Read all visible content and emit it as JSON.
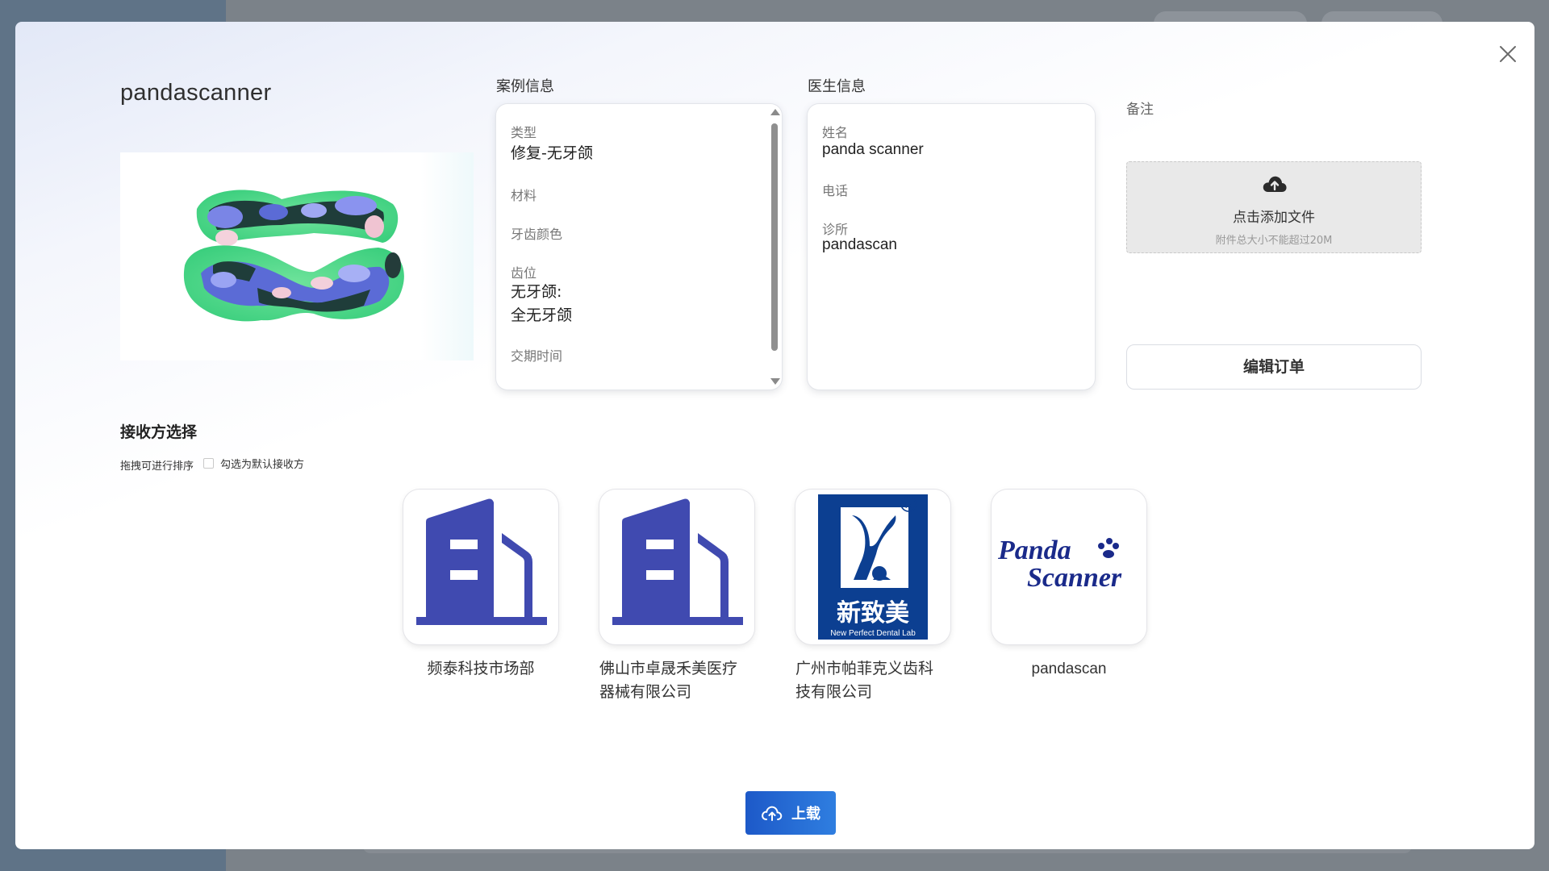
{
  "modal": {
    "title": "pandascanner",
    "case_info": {
      "heading": "案例信息",
      "fields": [
        {
          "label": "类型",
          "value": "修复-无牙颌"
        },
        {
          "label": "材料",
          "value": ""
        },
        {
          "label": "牙齿颜色",
          "value": ""
        },
        {
          "label": "齿位",
          "value_line1": "无牙颌:",
          "value_line2": "全无牙颌"
        },
        {
          "label": "交期时间",
          "value": ""
        }
      ]
    },
    "doctor_info": {
      "heading": "医生信息",
      "fields": [
        {
          "label": "姓名",
          "value": "panda scanner"
        },
        {
          "label": "电话",
          "value": ""
        },
        {
          "label": "诊所",
          "value": "pandascan"
        }
      ]
    },
    "notes": {
      "label": "备注",
      "upload_main": "点击添加文件",
      "upload_sub": "附件总大小不能超过20M",
      "upload_icon": "cloud-upload-icon"
    },
    "edit_order_label": "编辑订单",
    "receiver": {
      "title": "接收方选择",
      "hint": "拖拽可进行排序",
      "default_checkbox_label": "勾选为默认接收方",
      "default_checked": false,
      "orgs": [
        {
          "name": "频泰科技市场部",
          "logo": "building-icon"
        },
        {
          "name": "佛山市卓晟禾美医疗器械有限公司",
          "name_line1": "佛山市卓晟禾美医疗",
          "name_line2": "器械有限公司",
          "logo": "building-icon"
        },
        {
          "name": "广州市帕菲克义齿科技有限公司",
          "name_line1": "广州市帕菲克义齿科",
          "name_line2": "技有限公司",
          "logo": "new-perfect-logo",
          "logo_text_cn": "新致美",
          "logo_text_en": "New Perfect Dental Lab",
          "logo_mark": "®"
        },
        {
          "name": "pandascan",
          "logo": "panda-scanner-logo",
          "logo_line1": "Panda",
          "logo_line2": "Scanner"
        }
      ]
    },
    "submit_label": "上载",
    "colors": {
      "brand_blue": "#404ab0",
      "submit_blue": "#1d59c8",
      "new_perfect_blue": "#0c3f91"
    }
  }
}
